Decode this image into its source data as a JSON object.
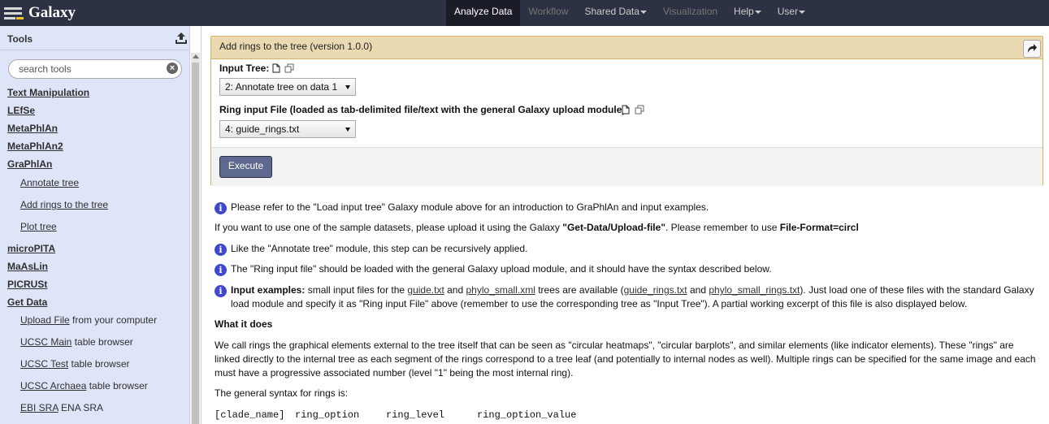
{
  "masthead": {
    "brand": "Galaxy",
    "nav": [
      {
        "label": "Analyze Data",
        "state": "active",
        "dropdown": false
      },
      {
        "label": "Workflow",
        "state": "disabled",
        "dropdown": false
      },
      {
        "label": "Shared Data",
        "state": "normal",
        "dropdown": true
      },
      {
        "label": "Visualization",
        "state": "disabled",
        "dropdown": false
      },
      {
        "label": "Help",
        "state": "normal",
        "dropdown": true
      },
      {
        "label": "User",
        "state": "normal",
        "dropdown": true
      }
    ]
  },
  "tool_panel": {
    "title": "Tools",
    "upload_icon": "upload-icon",
    "search_placeholder": "search tools",
    "sections": [
      {
        "label": "Text Manipulation"
      },
      {
        "label": "LEfSe"
      },
      {
        "label": "MetaPhlAn"
      },
      {
        "label": "MetaPhlAn2"
      },
      {
        "label": "GraPhlAn",
        "tools": [
          {
            "link": "Annotate tree",
            "desc": ""
          },
          {
            "link": "Add rings to the tree",
            "desc": ""
          },
          {
            "link": "Plot tree",
            "desc": ""
          }
        ]
      },
      {
        "label": "microPITA"
      },
      {
        "label": "MaAsLin"
      },
      {
        "label": "PICRUSt"
      },
      {
        "label": "Get Data",
        "tools": [
          {
            "link": "Upload File",
            "desc": "from your computer"
          },
          {
            "link": "UCSC Main",
            "desc": "table browser"
          },
          {
            "link": "UCSC Test",
            "desc": "table browser"
          },
          {
            "link": "UCSC Archaea",
            "desc": "table browser"
          },
          {
            "link": "EBI SRA",
            "desc": "ENA SRA"
          }
        ]
      }
    ]
  },
  "tool_form": {
    "title": "Add rings to the tree (version 1.0.0)",
    "fields": [
      {
        "label": "Input Tree:",
        "value": "2: Annotate tree on data 1"
      },
      {
        "label": "Ring input File (loaded as tab-delimited file/text with the general Galaxy upload module):",
        "value": "4: guide_rings.txt"
      }
    ],
    "execute_label": "Execute"
  },
  "help": {
    "p1": "Please refer to the \"Load input tree\" Galaxy module above for an introduction to GraPhlAn and input examples.",
    "p2_pre": "If you want to use one of the sample datasets, please upload it using the Galaxy ",
    "p2_bold1": "\"Get-Data/Upload-file\"",
    "p2_mid": ". Please remember to use ",
    "p2_bold2": "File-Format=circl",
    "p3": "Like the \"Annotate tree\" module, this step can be recursively applied.",
    "p4": "The \"Ring input file\" should be loaded with the general Galaxy upload module, and it should have the syntax described below.",
    "p5_bold": "Input examples:",
    "p5_a": " small input files for the ",
    "p5_l1": "guide.txt",
    "p5_b": " and ",
    "p5_l2": "phylo_small.xml",
    "p5_c": " trees are available (",
    "p5_l3": "guide_rings.txt",
    "p5_d": " and ",
    "p5_l4": "phylo_small_rings.txt",
    "p5_e": "). Just load one of these files with the standard Galaxy load module and specify it as \"Ring input File\" above (remember to use the corresponding tree as \"Input Tree\"). A partial working excerpt of this file is also displayed below.",
    "heading": "What it does",
    "p6": "We call rings the graphical elements external to the tree itself that can be seen as \"circular heatmaps\", \"circular barplots\", and similar elements (like indicator elements). These \"rings\" are linked directly to the internal tree as each segment of the rings correspond to a tree leaf (and potentially to internal nodes as well). Multiple rings can be specified for the same image and each must have a progressive associated number (level \"1\" being the most internal ring).",
    "p7": "The general syntax for rings is:",
    "syntax": [
      "[clade_name]",
      "ring_option",
      "ring_level",
      "ring_option_value"
    ]
  }
}
